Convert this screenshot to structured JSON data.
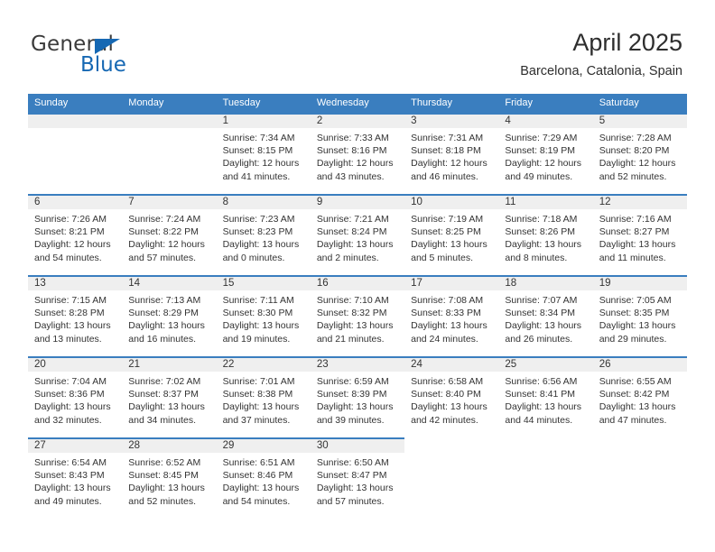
{
  "brand": {
    "name_part1": "General",
    "name_part2": "Blue",
    "accent_color": "#1668b3"
  },
  "header": {
    "title": "April 2025",
    "subtitle": "Barcelona, Catalonia, Spain"
  },
  "calendar": {
    "header_bg": "#3a7ebf",
    "date_band_bg": "#efefef",
    "weekdays": [
      "Sunday",
      "Monday",
      "Tuesday",
      "Wednesday",
      "Thursday",
      "Friday",
      "Saturday"
    ],
    "weeks": [
      [
        {
          "date": "",
          "blank": true
        },
        {
          "date": "",
          "blank": true
        },
        {
          "date": "1",
          "sunrise": "Sunrise: 7:34 AM",
          "sunset": "Sunset: 8:15 PM",
          "daylight_line1": "Daylight: 12 hours",
          "daylight_line2": "and 41 minutes."
        },
        {
          "date": "2",
          "sunrise": "Sunrise: 7:33 AM",
          "sunset": "Sunset: 8:16 PM",
          "daylight_line1": "Daylight: 12 hours",
          "daylight_line2": "and 43 minutes."
        },
        {
          "date": "3",
          "sunrise": "Sunrise: 7:31 AM",
          "sunset": "Sunset: 8:18 PM",
          "daylight_line1": "Daylight: 12 hours",
          "daylight_line2": "and 46 minutes."
        },
        {
          "date": "4",
          "sunrise": "Sunrise: 7:29 AM",
          "sunset": "Sunset: 8:19 PM",
          "daylight_line1": "Daylight: 12 hours",
          "daylight_line2": "and 49 minutes."
        },
        {
          "date": "5",
          "sunrise": "Sunrise: 7:28 AM",
          "sunset": "Sunset: 8:20 PM",
          "daylight_line1": "Daylight: 12 hours",
          "daylight_line2": "and 52 minutes."
        }
      ],
      [
        {
          "date": "6",
          "sunrise": "Sunrise: 7:26 AM",
          "sunset": "Sunset: 8:21 PM",
          "daylight_line1": "Daylight: 12 hours",
          "daylight_line2": "and 54 minutes."
        },
        {
          "date": "7",
          "sunrise": "Sunrise: 7:24 AM",
          "sunset": "Sunset: 8:22 PM",
          "daylight_line1": "Daylight: 12 hours",
          "daylight_line2": "and 57 minutes."
        },
        {
          "date": "8",
          "sunrise": "Sunrise: 7:23 AM",
          "sunset": "Sunset: 8:23 PM",
          "daylight_line1": "Daylight: 13 hours",
          "daylight_line2": "and 0 minutes."
        },
        {
          "date": "9",
          "sunrise": "Sunrise: 7:21 AM",
          "sunset": "Sunset: 8:24 PM",
          "daylight_line1": "Daylight: 13 hours",
          "daylight_line2": "and 2 minutes."
        },
        {
          "date": "10",
          "sunrise": "Sunrise: 7:19 AM",
          "sunset": "Sunset: 8:25 PM",
          "daylight_line1": "Daylight: 13 hours",
          "daylight_line2": "and 5 minutes."
        },
        {
          "date": "11",
          "sunrise": "Sunrise: 7:18 AM",
          "sunset": "Sunset: 8:26 PM",
          "daylight_line1": "Daylight: 13 hours",
          "daylight_line2": "and 8 minutes."
        },
        {
          "date": "12",
          "sunrise": "Sunrise: 7:16 AM",
          "sunset": "Sunset: 8:27 PM",
          "daylight_line1": "Daylight: 13 hours",
          "daylight_line2": "and 11 minutes."
        }
      ],
      [
        {
          "date": "13",
          "sunrise": "Sunrise: 7:15 AM",
          "sunset": "Sunset: 8:28 PM",
          "daylight_line1": "Daylight: 13 hours",
          "daylight_line2": "and 13 minutes."
        },
        {
          "date": "14",
          "sunrise": "Sunrise: 7:13 AM",
          "sunset": "Sunset: 8:29 PM",
          "daylight_line1": "Daylight: 13 hours",
          "daylight_line2": "and 16 minutes."
        },
        {
          "date": "15",
          "sunrise": "Sunrise: 7:11 AM",
          "sunset": "Sunset: 8:30 PM",
          "daylight_line1": "Daylight: 13 hours",
          "daylight_line2": "and 19 minutes."
        },
        {
          "date": "16",
          "sunrise": "Sunrise: 7:10 AM",
          "sunset": "Sunset: 8:32 PM",
          "daylight_line1": "Daylight: 13 hours",
          "daylight_line2": "and 21 minutes."
        },
        {
          "date": "17",
          "sunrise": "Sunrise: 7:08 AM",
          "sunset": "Sunset: 8:33 PM",
          "daylight_line1": "Daylight: 13 hours",
          "daylight_line2": "and 24 minutes."
        },
        {
          "date": "18",
          "sunrise": "Sunrise: 7:07 AM",
          "sunset": "Sunset: 8:34 PM",
          "daylight_line1": "Daylight: 13 hours",
          "daylight_line2": "and 26 minutes."
        },
        {
          "date": "19",
          "sunrise": "Sunrise: 7:05 AM",
          "sunset": "Sunset: 8:35 PM",
          "daylight_line1": "Daylight: 13 hours",
          "daylight_line2": "and 29 minutes."
        }
      ],
      [
        {
          "date": "20",
          "sunrise": "Sunrise: 7:04 AM",
          "sunset": "Sunset: 8:36 PM",
          "daylight_line1": "Daylight: 13 hours",
          "daylight_line2": "and 32 minutes."
        },
        {
          "date": "21",
          "sunrise": "Sunrise: 7:02 AM",
          "sunset": "Sunset: 8:37 PM",
          "daylight_line1": "Daylight: 13 hours",
          "daylight_line2": "and 34 minutes."
        },
        {
          "date": "22",
          "sunrise": "Sunrise: 7:01 AM",
          "sunset": "Sunset: 8:38 PM",
          "daylight_line1": "Daylight: 13 hours",
          "daylight_line2": "and 37 minutes."
        },
        {
          "date": "23",
          "sunrise": "Sunrise: 6:59 AM",
          "sunset": "Sunset: 8:39 PM",
          "daylight_line1": "Daylight: 13 hours",
          "daylight_line2": "and 39 minutes."
        },
        {
          "date": "24",
          "sunrise": "Sunrise: 6:58 AM",
          "sunset": "Sunset: 8:40 PM",
          "daylight_line1": "Daylight: 13 hours",
          "daylight_line2": "and 42 minutes."
        },
        {
          "date": "25",
          "sunrise": "Sunrise: 6:56 AM",
          "sunset": "Sunset: 8:41 PM",
          "daylight_line1": "Daylight: 13 hours",
          "daylight_line2": "and 44 minutes."
        },
        {
          "date": "26",
          "sunrise": "Sunrise: 6:55 AM",
          "sunset": "Sunset: 8:42 PM",
          "daylight_line1": "Daylight: 13 hours",
          "daylight_line2": "and 47 minutes."
        }
      ],
      [
        {
          "date": "27",
          "sunrise": "Sunrise: 6:54 AM",
          "sunset": "Sunset: 8:43 PM",
          "daylight_line1": "Daylight: 13 hours",
          "daylight_line2": "and 49 minutes."
        },
        {
          "date": "28",
          "sunrise": "Sunrise: 6:52 AM",
          "sunset": "Sunset: 8:45 PM",
          "daylight_line1": "Daylight: 13 hours",
          "daylight_line2": "and 52 minutes."
        },
        {
          "date": "29",
          "sunrise": "Sunrise: 6:51 AM",
          "sunset": "Sunset: 8:46 PM",
          "daylight_line1": "Daylight: 13 hours",
          "daylight_line2": "and 54 minutes."
        },
        {
          "date": "30",
          "sunrise": "Sunrise: 6:50 AM",
          "sunset": "Sunset: 8:47 PM",
          "daylight_line1": "Daylight: 13 hours",
          "daylight_line2": "and 57 minutes."
        },
        {
          "date": "",
          "trailing": true
        },
        {
          "date": "",
          "trailing": true
        },
        {
          "date": "",
          "trailing": true
        }
      ]
    ]
  }
}
